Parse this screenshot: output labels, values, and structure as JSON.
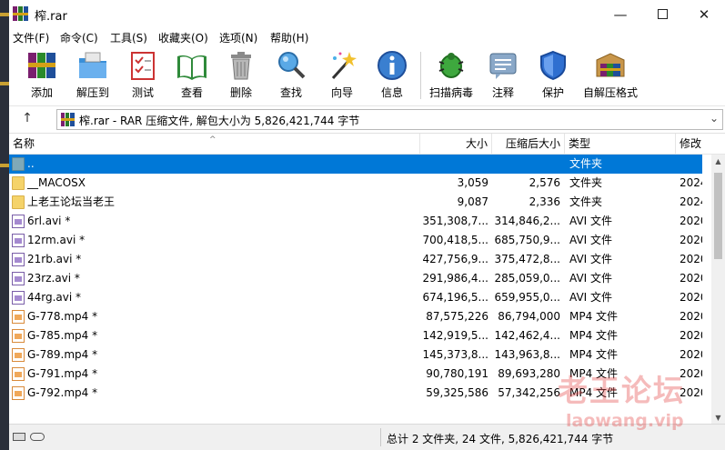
{
  "window": {
    "title": "榨.rar",
    "minimize_glyph": "—",
    "close_glyph": "✕"
  },
  "menu": [
    {
      "label": "文件(F)"
    },
    {
      "label": "命令(C)"
    },
    {
      "label": "工具(S)"
    },
    {
      "label": "收藏夹(O)"
    },
    {
      "label": "选项(N)"
    },
    {
      "label": "帮助(H)"
    }
  ],
  "toolbar": [
    {
      "label": "添加",
      "icon": "add-archive-icon"
    },
    {
      "label": "解压到",
      "icon": "extract-to-icon"
    },
    {
      "label": "测试",
      "icon": "test-icon"
    },
    {
      "label": "查看",
      "icon": "view-icon"
    },
    {
      "label": "删除",
      "icon": "delete-icon"
    },
    {
      "label": "查找",
      "icon": "find-icon"
    },
    {
      "label": "向导",
      "icon": "wizard-icon"
    },
    {
      "label": "信息",
      "icon": "info-icon"
    },
    {
      "label": "扫描病毒",
      "icon": "virus-scan-icon"
    },
    {
      "label": "注释",
      "icon": "comment-icon"
    },
    {
      "label": "保护",
      "icon": "protect-icon"
    },
    {
      "label": "自解压格式",
      "icon": "sfx-icon"
    }
  ],
  "address": {
    "up_glyph": "↑",
    "path": "榨.rar - RAR 压缩文件, 解包大小为 5,826,421,744 字节",
    "dropdown_glyph": "⌄"
  },
  "columns": {
    "name": "名称",
    "size": "大小",
    "packed": "压缩后大小",
    "type": "类型",
    "modified": "修改",
    "sort_glyph": "^"
  },
  "rows": [
    {
      "name": "..",
      "size": "",
      "packed": "",
      "type": "文件夹",
      "modified": "",
      "icon": "folder-up"
    },
    {
      "name": "__MACOSX",
      "size": "3,059",
      "packed": "2,576",
      "type": "文件夹",
      "modified": "2024",
      "icon": "folder"
    },
    {
      "name": "上老王论坛当老王",
      "size": "9,087",
      "packed": "2,336",
      "type": "文件夹",
      "modified": "2024",
      "icon": "folder"
    },
    {
      "name": "6rl.avi *",
      "size": "351,308,7...",
      "packed": "314,846,2...",
      "type": "AVI 文件",
      "modified": "2020",
      "icon": "avi"
    },
    {
      "name": "12rm.avi *",
      "size": "700,418,5...",
      "packed": "685,750,9...",
      "type": "AVI 文件",
      "modified": "2020",
      "icon": "avi"
    },
    {
      "name": "21rb.avi *",
      "size": "427,756,9...",
      "packed": "375,472,8...",
      "type": "AVI 文件",
      "modified": "2020",
      "icon": "avi"
    },
    {
      "name": "23rz.avi *",
      "size": "291,986,4...",
      "packed": "285,059,0...",
      "type": "AVI 文件",
      "modified": "2020",
      "icon": "avi"
    },
    {
      "name": "44rg.avi *",
      "size": "674,196,5...",
      "packed": "659,955,0...",
      "type": "AVI 文件",
      "modified": "2020",
      "icon": "avi"
    },
    {
      "name": "G-778.mp4 *",
      "size": "87,575,226",
      "packed": "86,794,000",
      "type": "MP4 文件",
      "modified": "2020",
      "icon": "mp4"
    },
    {
      "name": "G-785.mp4 *",
      "size": "142,919,5...",
      "packed": "142,462,4...",
      "type": "MP4 文件",
      "modified": "2020",
      "icon": "mp4"
    },
    {
      "name": "G-789.mp4 *",
      "size": "145,373,8...",
      "packed": "143,963,8...",
      "type": "MP4 文件",
      "modified": "2020",
      "icon": "mp4"
    },
    {
      "name": "G-791.mp4 *",
      "size": "90,780,191",
      "packed": "89,693,280",
      "type": "MP4 文件",
      "modified": "2020",
      "icon": "mp4"
    },
    {
      "name": "G-792.mp4 *",
      "size": "59,325,586",
      "packed": "57,342,256",
      "type": "MP4 文件",
      "modified": "2020",
      "icon": "mp4"
    }
  ],
  "scrollbar": {
    "up_glyph": "▲",
    "down_glyph": "▼"
  },
  "status": {
    "summary": "总计 2 文件夹, 24 文件, 5,826,421,744 字节"
  },
  "watermark": {
    "line1": "老王论坛",
    "line2": "laowang.vip"
  },
  "colors": {
    "selection": "#0078d7",
    "watermark": "#e13c3c"
  }
}
